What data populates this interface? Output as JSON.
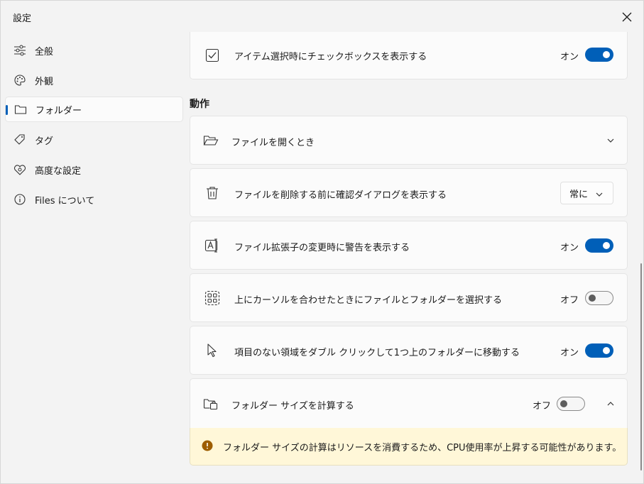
{
  "window": {
    "title": "設定"
  },
  "sidebar": {
    "items": [
      {
        "label": "全般",
        "icon": "sliders-icon"
      },
      {
        "label": "外観",
        "icon": "palette-icon"
      },
      {
        "label": "フォルダー",
        "icon": "folder-icon",
        "selected": true
      },
      {
        "label": "タグ",
        "icon": "tag-icon"
      },
      {
        "label": "高度な設定",
        "icon": "advanced-icon"
      },
      {
        "label": "Files について",
        "icon": "info-icon"
      }
    ]
  },
  "main": {
    "top_setting": {
      "label": "アイテム選択時にチェックボックスを表示する",
      "state": "オン",
      "on": true
    },
    "section_title": "動作",
    "open_files": {
      "label": "ファイルを開くとき"
    },
    "delete_confirm": {
      "label": "ファイルを削除する前に確認ダイアログを表示する",
      "value": "常に"
    },
    "ext_warning": {
      "label": "ファイル拡張子の変更時に警告を表示する",
      "state": "オン",
      "on": true
    },
    "hover_select": {
      "label": "上にカーソルを合わせたときにファイルとフォルダーを選択する",
      "state": "オフ",
      "on": false
    },
    "double_click_up": {
      "label": "項目のない領域をダブル クリックして1つ上のフォルダーに移動する",
      "state": "オン",
      "on": true
    },
    "folder_size": {
      "label": "フォルダー サイズを計算する",
      "state": "オフ",
      "on": false,
      "warning": "フォルダー サイズの計算はリソースを消費するため、CPU使用率が上昇する可能性があります。"
    }
  },
  "colors": {
    "accent": "#005fb8",
    "warning_bg": "#fff7d8",
    "warning_icon": "#9d5d00"
  }
}
